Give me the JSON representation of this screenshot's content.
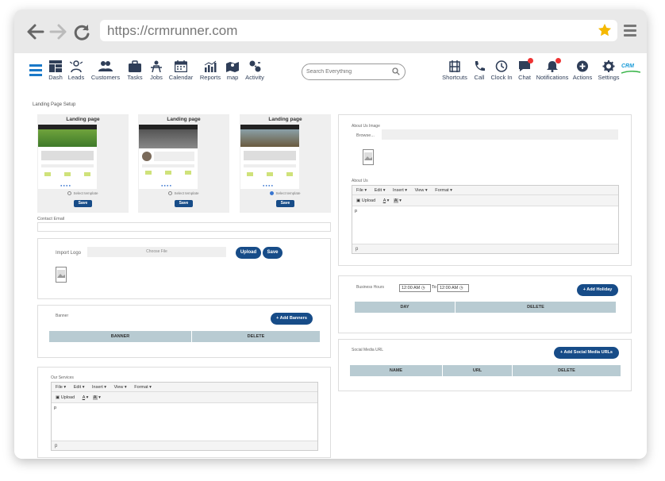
{
  "browser": {
    "url": "https://crmrunner.com"
  },
  "nav": {
    "items": [
      {
        "key": "dash",
        "label": "Dash"
      },
      {
        "key": "leads",
        "label": "Leads"
      },
      {
        "key": "customers",
        "label": "Customers"
      },
      {
        "key": "tasks",
        "label": "Tasks"
      },
      {
        "key": "jobs",
        "label": "Jobs"
      },
      {
        "key": "calendar",
        "label": "Calendar"
      },
      {
        "key": "reports",
        "label": "Reports"
      },
      {
        "key": "map",
        "label": "map"
      },
      {
        "key": "activity",
        "label": "Activity"
      }
    ],
    "search_placeholder": "Search Everything",
    "right_items": [
      {
        "key": "shortcuts",
        "label": "Shortcuts"
      },
      {
        "key": "call",
        "label": "Call"
      },
      {
        "key": "clockin",
        "label": "Clock In"
      },
      {
        "key": "chat",
        "label": "Chat"
      },
      {
        "key": "notifications",
        "label": "Notifications"
      },
      {
        "key": "actions",
        "label": "Actions"
      },
      {
        "key": "settings",
        "label": "Settings"
      }
    ],
    "logo_text": "CRM",
    "accent": "#1a79c8"
  },
  "page": {
    "title": "Landing Page Setup",
    "templates": [
      {
        "title": "Landing page",
        "radio": "Select template",
        "save": "Save",
        "selected": false
      },
      {
        "title": "Landing page",
        "radio": "Select template",
        "save": "Save",
        "selected": false
      },
      {
        "title": "Landing page",
        "radio": "Select template",
        "save": "Save",
        "selected": true
      }
    ],
    "contact_email_label": "Contact Email",
    "import_logo": {
      "label": "Import Logo",
      "file_text": "Choose File",
      "upload": "Upload",
      "save": "Save"
    },
    "banner": {
      "label": "Banner",
      "add_button": "+ Add Banners",
      "columns": [
        "BANNER",
        "DELETE"
      ]
    },
    "our_services": {
      "label": "Our Services",
      "menu": [
        "File ▾",
        "Edit ▾",
        "Insert ▾",
        "View ▾",
        "Format ▾"
      ],
      "upload": "Upload",
      "body": "p",
      "status": "p"
    },
    "about_us_image": {
      "label": "About Us Image",
      "browse": "Browse..."
    },
    "about_us": {
      "label": "About Us",
      "menu": [
        "File ▾",
        "Edit ▾",
        "Insert ▾",
        "View ▾",
        "Format ▾"
      ],
      "upload": "Upload",
      "body": "p",
      "status": "p"
    },
    "business_hours": {
      "label": "Business Hours",
      "from": "12:00 AM",
      "to_label": "To",
      "to": "12:00 AM",
      "add_button": "+ Add Holiday",
      "columns": [
        "DAY",
        "DELETE"
      ]
    },
    "social_media": {
      "label": "Social Media URL",
      "add_button": "+ Add Social Media URLs",
      "columns": [
        "NAME",
        "URL",
        "DELETE"
      ]
    }
  },
  "colors": {
    "primary_button": "#174c88",
    "table_header": "#b8cbd2"
  }
}
